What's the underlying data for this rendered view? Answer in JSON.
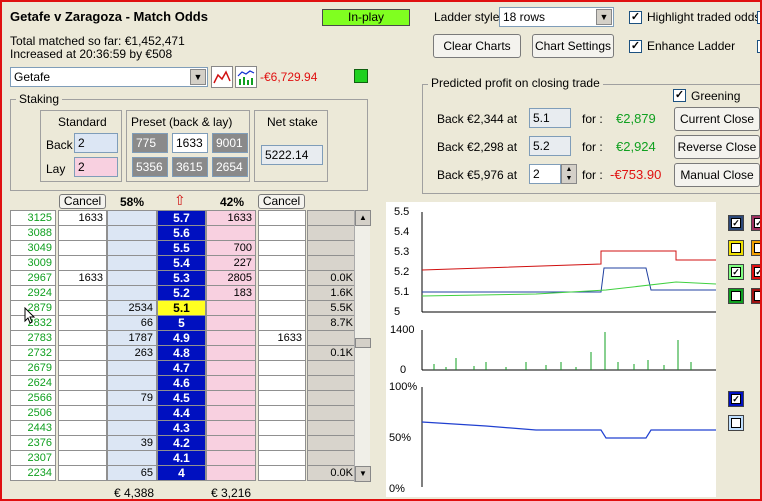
{
  "title": "Getafe v Zaragoza - Match Odds",
  "total_matched": "Total matched so far: €1,452,471",
  "increased": "Increased at 20:36:59 by €508",
  "inplay": "In-play",
  "ladder_style_label": "Ladder style",
  "ladder_style_value": "18 rows",
  "highlight_label": "Highlight traded odds",
  "enhance_label": "Enhance Ladder",
  "clear_charts": "Clear Charts",
  "chart_settings": "Chart Settings",
  "selection": "Getafe",
  "selection_pl": "-€6,729.94",
  "staking": {
    "label": "Staking",
    "standard": "Standard",
    "preset": "Preset (back & lay)",
    "net_stake": "Net stake",
    "back_label": "Back",
    "lay_label": "Lay",
    "back_value": "2",
    "lay_value": "2",
    "preset_back": [
      "775",
      "1633",
      "9001"
    ],
    "preset_lay": [
      "5356",
      "3615",
      "2654"
    ],
    "net_value": "5222.14"
  },
  "predicted": {
    "label": "Predicted profit on closing trade",
    "greening": "Greening",
    "rows": [
      {
        "text": "Back  €2,344  at",
        "price": "5.1",
        "for": "for :",
        "profit": "€2,879",
        "button": "Current Close"
      },
      {
        "text": "Back  €2,298  at",
        "price": "5.2",
        "for": "for :",
        "profit": "€2,924",
        "button": "Reverse Close"
      },
      {
        "text": "Back  €5,976  at",
        "price": "2",
        "for": "for :",
        "profit": "-€753.90",
        "button": "Manual Close"
      }
    ]
  },
  "ladder": {
    "cancel": "Cancel",
    "back_pct": "58%",
    "lay_pct": "42%",
    "back_total": "€ 4,388",
    "lay_total": "€ 3,216",
    "rows": [
      {
        "sel": "3125",
        "b1": "1633",
        "back": "",
        "price": "5.7",
        "lay": "1633",
        "b2": "",
        "vol": ""
      },
      {
        "sel": "3088",
        "b1": "",
        "back": "",
        "price": "5.6",
        "lay": "",
        "b2": "",
        "vol": ""
      },
      {
        "sel": "3049",
        "b1": "",
        "back": "",
        "price": "5.5",
        "lay": "700",
        "b2": "",
        "vol": ""
      },
      {
        "sel": "3009",
        "b1": "",
        "back": "",
        "price": "5.4",
        "lay": "227",
        "b2": "",
        "vol": ""
      },
      {
        "sel": "2967",
        "b1": "1633",
        "back": "",
        "price": "5.3",
        "lay": "2805",
        "b2": "",
        "vol": "0.0K"
      },
      {
        "sel": "2924",
        "b1": "",
        "back": "",
        "price": "5.2",
        "lay": "183",
        "b2": "",
        "vol": "1.6K"
      },
      {
        "sel": "2879",
        "b1": "",
        "back": "2534",
        "price": "5.1",
        "lay": "",
        "b2": "",
        "vol": "5.5K"
      },
      {
        "sel": "2832",
        "b1": "",
        "back": "66",
        "price": "5",
        "lay": "",
        "b2": "",
        "vol": "8.7K"
      },
      {
        "sel": "2783",
        "b1": "",
        "back": "1787",
        "price": "4.9",
        "lay": "",
        "b2": "1633",
        "vol": ""
      },
      {
        "sel": "2732",
        "b1": "",
        "back": "263",
        "price": "4.8",
        "lay": "",
        "b2": "",
        "vol": "0.1K"
      },
      {
        "sel": "2679",
        "b1": "",
        "back": "",
        "price": "4.7",
        "lay": "",
        "b2": "",
        "vol": ""
      },
      {
        "sel": "2624",
        "b1": "",
        "back": "",
        "price": "4.6",
        "lay": "",
        "b2": "",
        "vol": ""
      },
      {
        "sel": "2566",
        "b1": "",
        "back": "79",
        "price": "4.5",
        "lay": "",
        "b2": "",
        "vol": ""
      },
      {
        "sel": "2506",
        "b1": "",
        "back": "",
        "price": "4.4",
        "lay": "",
        "b2": "",
        "vol": ""
      },
      {
        "sel": "2443",
        "b1": "",
        "back": "",
        "price": "4.3",
        "lay": "",
        "b2": "",
        "vol": ""
      },
      {
        "sel": "2376",
        "b1": "",
        "back": "39",
        "price": "4.2",
        "lay": "",
        "b2": "",
        "vol": ""
      },
      {
        "sel": "2307",
        "b1": "",
        "back": "",
        "price": "4.1",
        "lay": "",
        "b2": "",
        "vol": ""
      },
      {
        "sel": "2234",
        "b1": "",
        "back": "65",
        "price": "4",
        "lay": "",
        "b2": "",
        "vol": "0.0K"
      }
    ]
  },
  "charts": {
    "price_ticks": [
      "5.5",
      "5.4",
      "5.3",
      "5.2",
      "5.1",
      "5"
    ],
    "volume_ticks": [
      "1400",
      "0"
    ],
    "pct_ticks": [
      "100%",
      "50%",
      "0%"
    ]
  },
  "colors": {
    "accent_green": "#80ff20",
    "price_blue": "#0010c0",
    "highlight": "#ffff20",
    "loss": "#e01010",
    "profit": "#10a020"
  }
}
